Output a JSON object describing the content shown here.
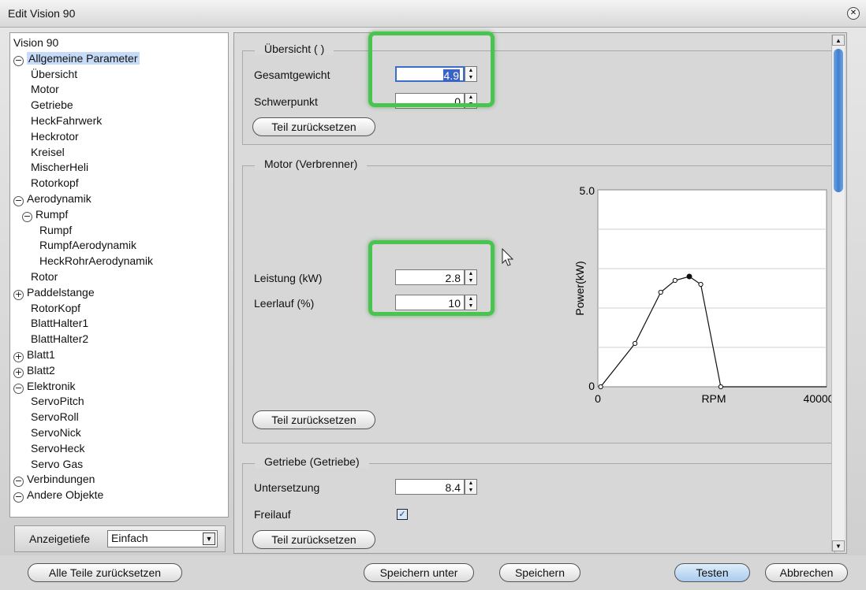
{
  "window": {
    "title": "Edit Vision 90",
    "close_glyph": "✕"
  },
  "tree": {
    "items": [
      {
        "label": "Vision 90",
        "toggle": ""
      },
      {
        "label": "Allgemeine Parameter",
        "toggle": "−"
      },
      {
        "label": "Übersicht",
        "toggle": ""
      },
      {
        "label": "Motor",
        "toggle": ""
      },
      {
        "label": "Getriebe",
        "toggle": ""
      },
      {
        "label": "HeckFahrwerk",
        "toggle": ""
      },
      {
        "label": "Heckrotor",
        "toggle": ""
      },
      {
        "label": "Kreisel",
        "toggle": ""
      },
      {
        "label": "MischerHeli",
        "toggle": ""
      },
      {
        "label": "Rotorkopf",
        "toggle": ""
      },
      {
        "label": "Aerodynamik",
        "toggle": "−"
      },
      {
        "label": "Rumpf",
        "toggle": "−"
      },
      {
        "label": "Rumpf",
        "toggle": ""
      },
      {
        "label": "RumpfAerodynamik",
        "toggle": ""
      },
      {
        "label": "HeckRohrAerodynamik",
        "toggle": ""
      },
      {
        "label": "Rotor",
        "toggle": ""
      },
      {
        "label": "Paddelstange",
        "toggle": "+"
      },
      {
        "label": "RotorKopf",
        "toggle": ""
      },
      {
        "label": "BlattHalter1",
        "toggle": ""
      },
      {
        "label": "BlattHalter2",
        "toggle": ""
      },
      {
        "label": "Blatt1",
        "toggle": "+"
      },
      {
        "label": "Blatt2",
        "toggle": "+"
      },
      {
        "label": "Elektronik",
        "toggle": "−"
      },
      {
        "label": "ServoPitch",
        "toggle": ""
      },
      {
        "label": "ServoRoll",
        "toggle": ""
      },
      {
        "label": "ServoNick",
        "toggle": ""
      },
      {
        "label": "ServoHeck",
        "toggle": ""
      },
      {
        "label": "Servo Gas",
        "toggle": ""
      },
      {
        "label": "Verbindungen",
        "toggle": "−"
      },
      {
        "label": "Andere Objekte",
        "toggle": "−"
      }
    ],
    "selected_index": 1
  },
  "display_depth": {
    "label": "Anzeigetiefe",
    "value": "Einfach",
    "arrow": "▼"
  },
  "overview": {
    "legend": "Übersicht ( )",
    "weight_label": "Gesamtgewicht",
    "weight_value": "4.9",
    "cg_label": "Schwerpunkt",
    "cg_value": "0",
    "reset_label": "Teil zurücksetzen"
  },
  "motor": {
    "legend": "Motor (Verbrenner)",
    "power_label": "Leistung (kW)",
    "power_value": "2.8",
    "idle_label": "Leerlauf (%)",
    "idle_value": "10",
    "reset_label": "Teil zurücksetzen"
  },
  "gearbox": {
    "legend": "Getriebe (Getriebe)",
    "ratio_label": "Untersetzung",
    "ratio_value": "8.4",
    "freewheel_label": "Freilauf",
    "freewheel_checked": true,
    "reset_label": "Teil zurücksetzen"
  },
  "chart_data": {
    "type": "line",
    "title": "",
    "xlabel": "RPM",
    "ylabel": "Power(kW)",
    "xlim": [
      0,
      40000
    ],
    "ylim": [
      0,
      5.0
    ],
    "x_tick_labels": [
      "0",
      "40000"
    ],
    "y_tick_labels": [
      "0",
      "5.0"
    ],
    "grid": true,
    "series": [
      {
        "x": [
          500,
          6500,
          11000,
          13500,
          16000,
          18000,
          21500,
          40000
        ],
        "y": [
          0,
          1.1,
          2.4,
          2.7,
          2.8,
          2.6,
          0,
          0
        ],
        "highlight_index": 4
      }
    ]
  },
  "buttons": {
    "reset_all": "Alle Teile zurücksetzen",
    "save_as": "Speichern unter",
    "save": "Speichern",
    "test": "Testen",
    "cancel": "Abbrechen"
  },
  "colors": {
    "highlight": "#49c450",
    "selection": "#c6dbf7",
    "primary_button": "#a9cbee"
  }
}
